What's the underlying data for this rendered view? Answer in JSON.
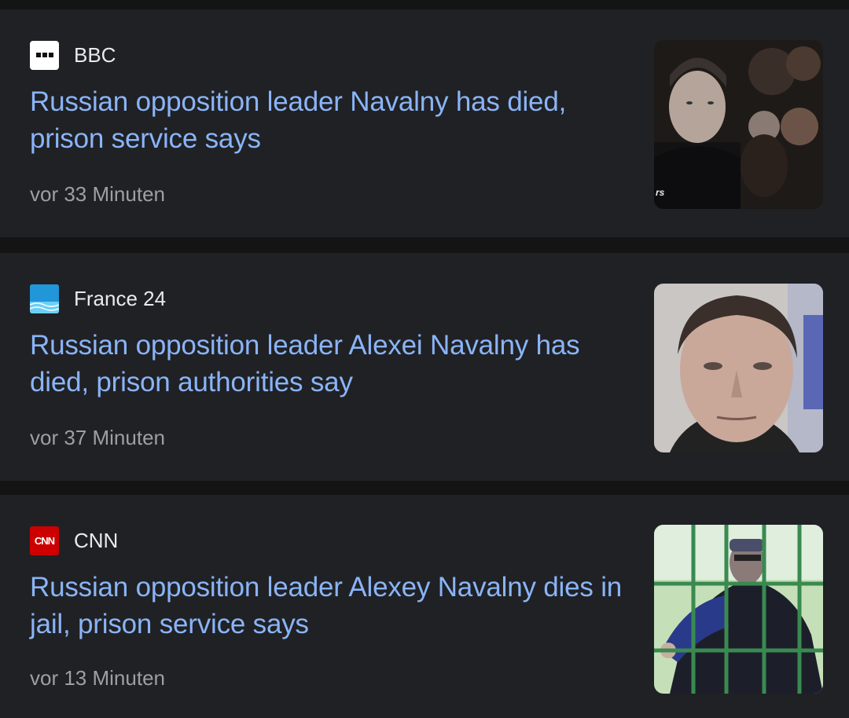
{
  "articles": [
    {
      "source": "BBC",
      "source_icon": "bbc-logo-icon",
      "headline": "Russian opposition leader Navalny has died, prison service says",
      "time": "vor 33 Minuten",
      "thumbnail": "navalny-crowd-photo"
    },
    {
      "source": "France 24",
      "source_icon": "france24-logo-icon",
      "logo_text": "FRANCE 24",
      "headline": "Russian opposition leader Alexei Navalny has died, prison authorities say",
      "time": "vor 37 Minuten",
      "thumbnail": "navalny-portrait-photo"
    },
    {
      "source": "CNN",
      "source_icon": "cnn-logo-icon",
      "logo_text": "CNN",
      "headline": "Russian opposition leader Alexey Navalny dies in jail, prison service says",
      "time": "vor 13 Minuten",
      "thumbnail": "navalny-behind-bars-photo"
    }
  ],
  "colors": {
    "background": "#141414",
    "card": "#202124",
    "headline": "#8ab4f8",
    "source": "#e8eaed",
    "time": "#9aa0a6",
    "cnn_red": "#cc0000"
  }
}
